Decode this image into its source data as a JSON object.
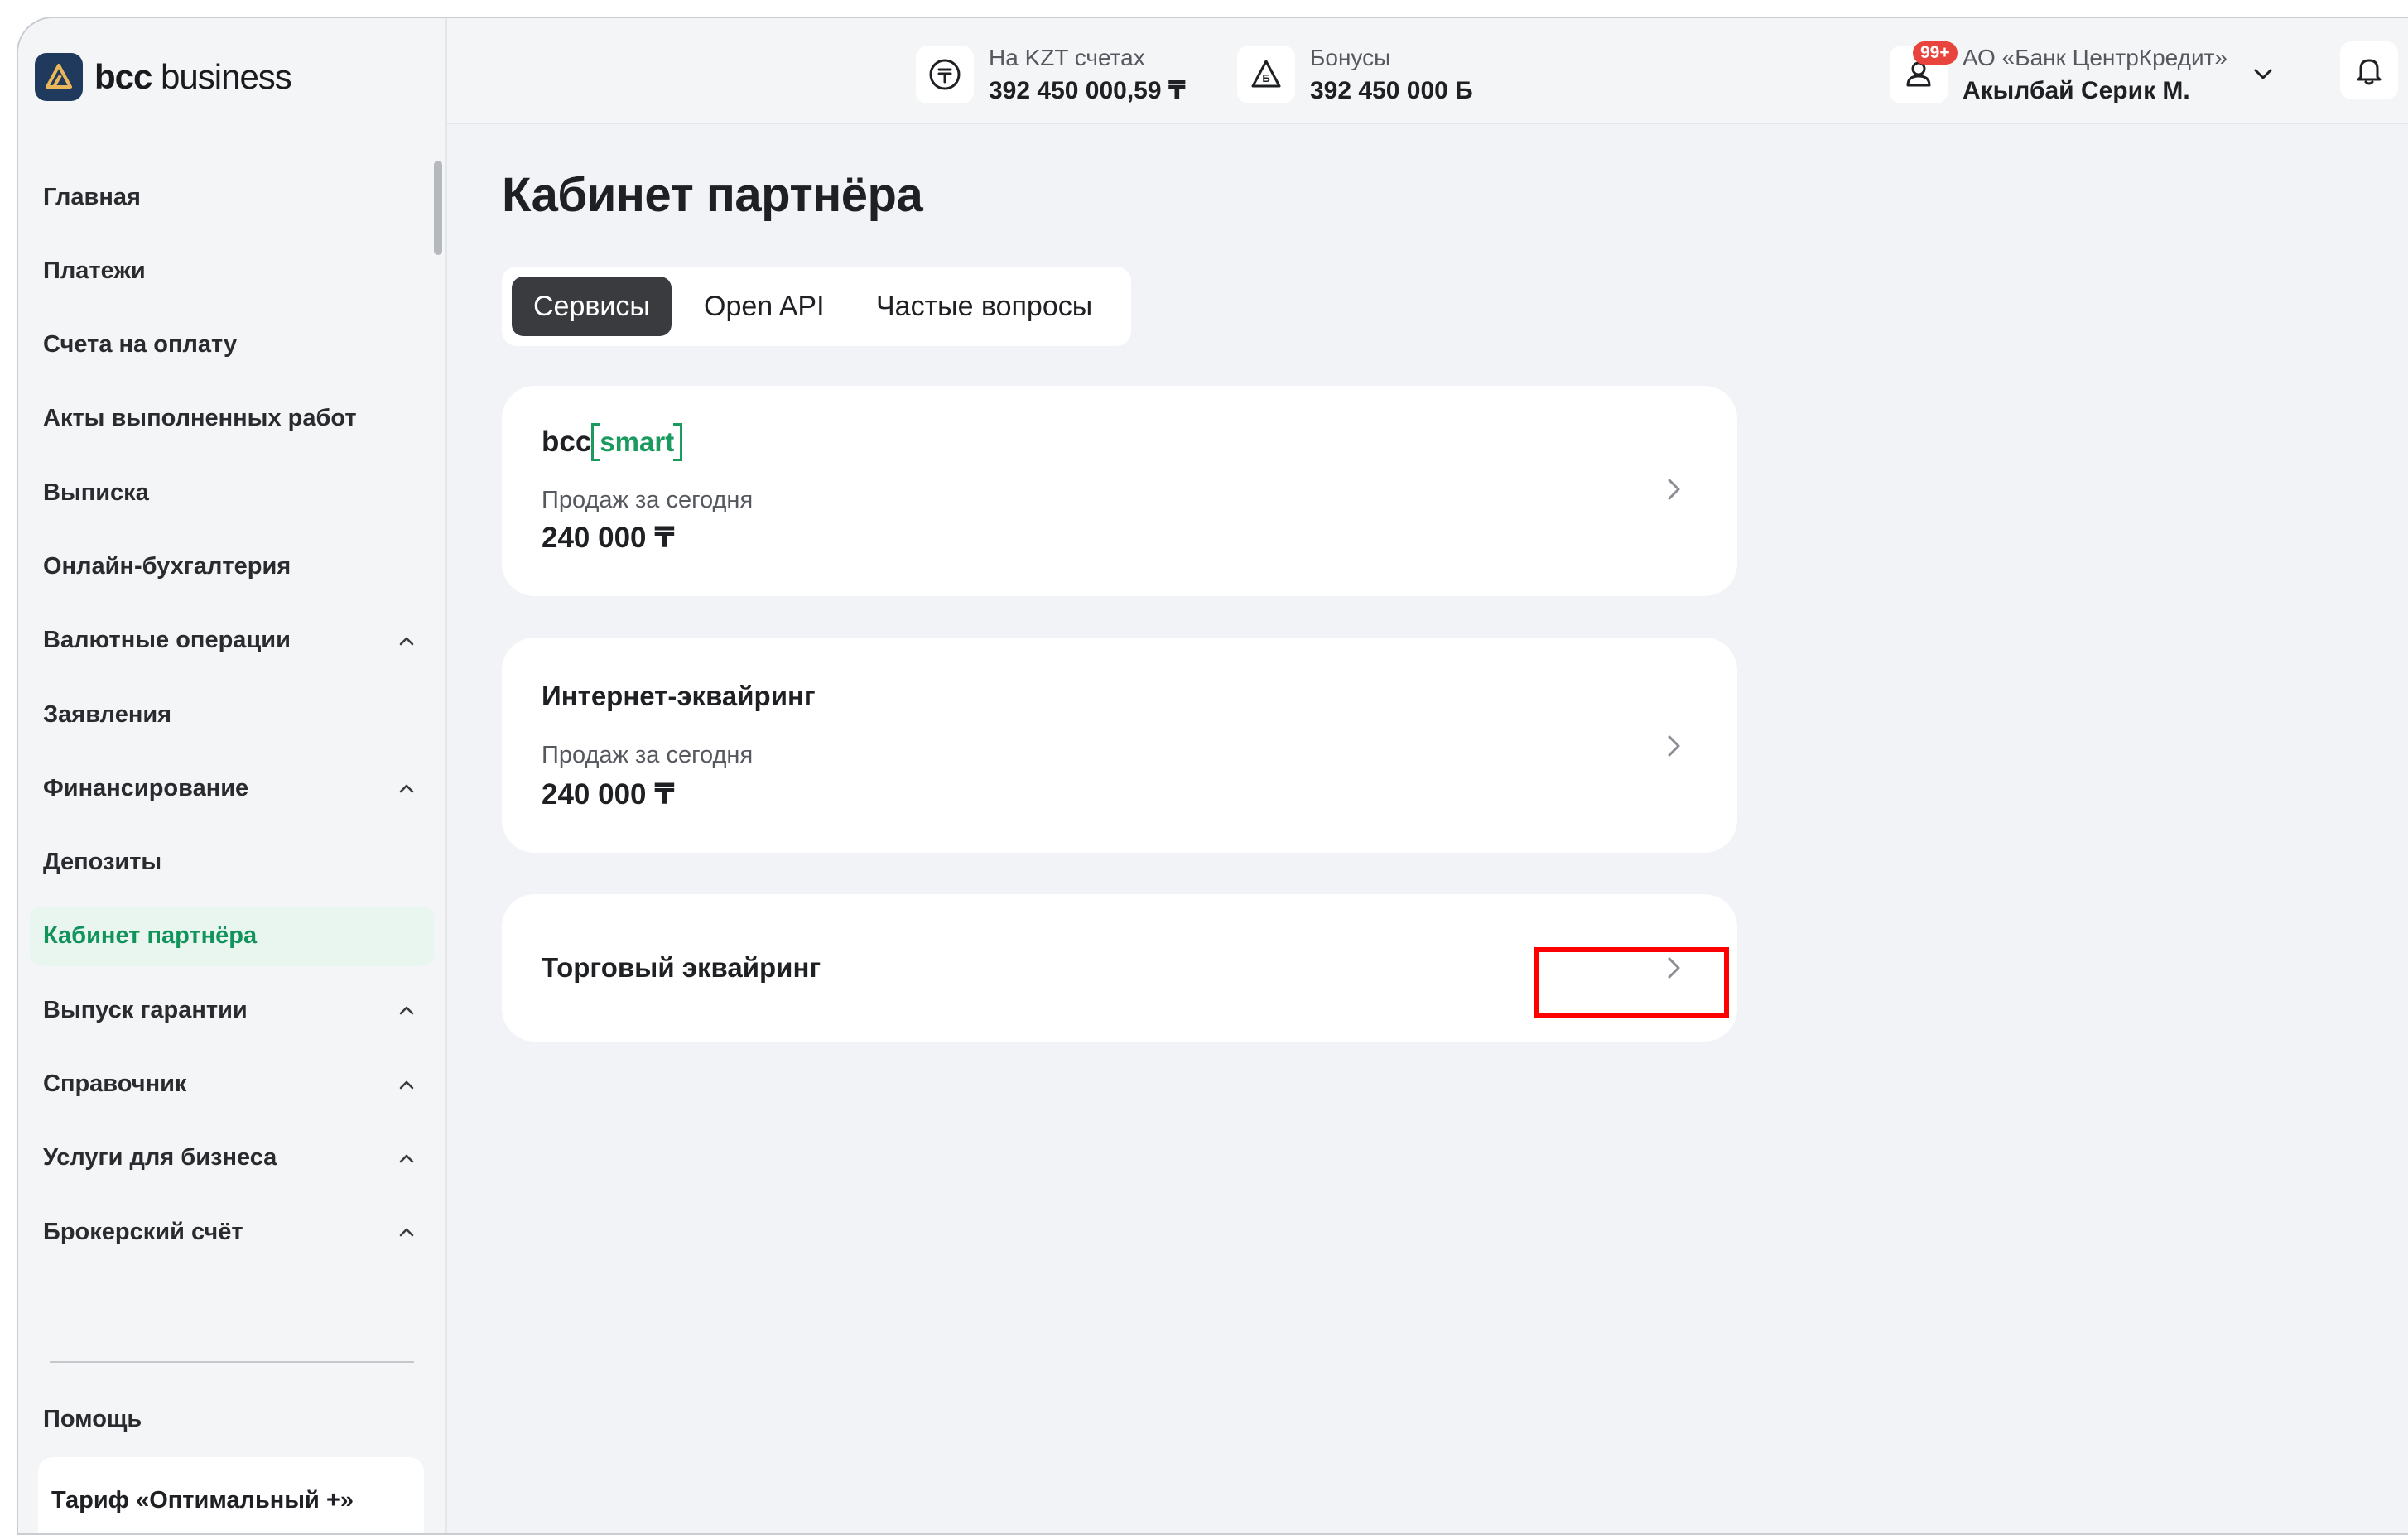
{
  "brand": {
    "name_bold": "bcc",
    "name_rest": " business"
  },
  "header": {
    "balance_label": "На KZT счетах",
    "balance_value": "392 450 000,59 ₸",
    "bonus_label": "Бонусы",
    "bonus_value": "392 450 000 Б",
    "company": "АО «Банк ЦентрКредит»",
    "user": "Акылбай Серик М.",
    "notifications": "99+"
  },
  "sidebar": {
    "items": [
      {
        "label": "Главная"
      },
      {
        "label": "Платежи"
      },
      {
        "label": "Счета на оплату"
      },
      {
        "label": "Акты выполненных работ"
      },
      {
        "label": "Выписка"
      },
      {
        "label": "Онлайн-бухгалтерия"
      },
      {
        "label": "Валютные операции"
      },
      {
        "label": "Заявления"
      },
      {
        "label": "Финансирование"
      },
      {
        "label": "Депозиты"
      },
      {
        "label": "Кабинет партнёра"
      },
      {
        "label": "Выпуск гарантии"
      },
      {
        "label": "Справочник"
      },
      {
        "label": "Услуги для бизнеса"
      },
      {
        "label": "Брокерский счёт"
      }
    ],
    "help": "Помощь",
    "tariff": "Тариф «Оптимальный +»"
  },
  "page": {
    "title": "Кабинет партнёра",
    "tabs": [
      "Сервисы",
      "Open API",
      "Частые вопросы"
    ]
  },
  "cards": [
    {
      "logo_bcc": "bcc",
      "logo_smart": "smart",
      "sub": "Продаж за сегодня",
      "amount": "240 000 ₸"
    },
    {
      "name": "Интернет-эквайринг",
      "sub": "Продаж за сегодня",
      "amount": "240 000 ₸"
    },
    {
      "name": "Торговый эквайринг"
    }
  ],
  "colors": {
    "accent": "#11935b",
    "highlight": "#ff0000",
    "active_tab": "#3a3b3f"
  }
}
